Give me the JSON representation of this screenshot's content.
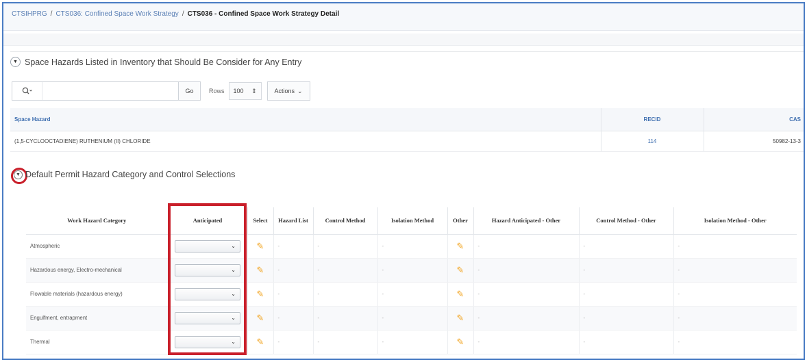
{
  "breadcrumb": {
    "items": [
      "CTSIHPRG",
      "CTS036: Confined Space Work Strategy"
    ],
    "separator": "/",
    "current": "CTS036 - Confined Space Work Strategy Detail"
  },
  "region1": {
    "title": "Space Hazards Listed in Inventory that Should Be Consider for Any Entry",
    "toolbar": {
      "search_value": "",
      "go_label": "Go",
      "rows_label": "Rows",
      "rows_value": "100",
      "actions_label": "Actions"
    },
    "columns": [
      "Space Hazard",
      "RECID",
      "CAS"
    ],
    "rows": [
      {
        "space_hazard": "(1,5-CYCLOOCTADIENE) RUTHENIUM (II) CHLORIDE",
        "recid": "114",
        "cas": "50982-13-3"
      }
    ]
  },
  "region2": {
    "title": "Default Permit Hazard Category and Control Selections",
    "columns": [
      "Work Hazard Category",
      "Anticipated",
      "Select",
      "Hazard List",
      "Control Method",
      "Isolation Method",
      "Other",
      "Hazard Anticipated - Other",
      "Control Method - Other",
      "Isolation Method - Other"
    ],
    "rows": [
      {
        "category": "Atmospheric",
        "anticipated": "",
        "hazard_list": "-",
        "control_method": "-",
        "isolation_method": "-",
        "hazard_other": "-",
        "control_other": "-",
        "isolation_other": "-"
      },
      {
        "category": "Hazardous energy, Electro-mechanical",
        "anticipated": "",
        "hazard_list": "-",
        "control_method": "-",
        "isolation_method": "-",
        "hazard_other": "-",
        "control_other": "-",
        "isolation_other": "-"
      },
      {
        "category": "Flowable materials (hazardous energy)",
        "anticipated": "",
        "hazard_list": "-",
        "control_method": "-",
        "isolation_method": "-",
        "hazard_other": "-",
        "control_other": "-",
        "isolation_other": "-"
      },
      {
        "category": "Engulfment, entrapment",
        "anticipated": "",
        "hazard_list": "-",
        "control_method": "-",
        "isolation_method": "-",
        "hazard_other": "-",
        "control_other": "-",
        "isolation_other": "-"
      },
      {
        "category": "Thermal",
        "anticipated": "",
        "hazard_list": "-",
        "control_method": "-",
        "isolation_method": "-",
        "hazard_other": "-",
        "control_other": "-",
        "isolation_other": "-"
      }
    ]
  },
  "icons": {
    "collapse": "triangle-down-icon",
    "edit": "pencil-icon",
    "search": "search-icon"
  },
  "colors": {
    "link": "#3f6fb0",
    "highlight": "#c91f2a",
    "edit_icon": "#f2a522",
    "frame_border": "#4a7cc4"
  }
}
